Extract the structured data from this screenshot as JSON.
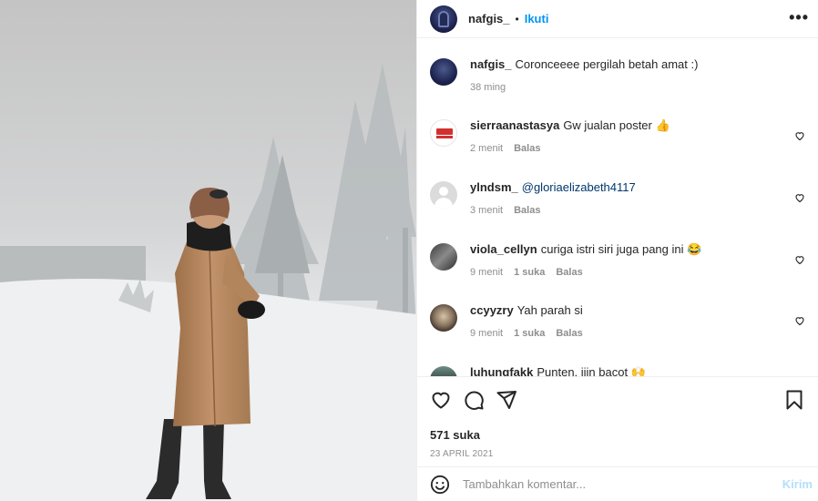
{
  "post": {
    "image_alt": "Woman in camel coat standing in snowy foggy landscape",
    "author": "nafgis_",
    "dot": "•",
    "follow_label": "Ikuti",
    "more_label": "•••"
  },
  "caption": {
    "user": "nafgis_",
    "text": "Coronceeee pergilah betah amat :)",
    "time": "38 ming"
  },
  "comments": [
    {
      "user": "sierraanastasya",
      "text": "Gw jualan poster 👍",
      "time": "2 menit",
      "likes": "",
      "reply": "Balas"
    },
    {
      "user": "ylndsm_",
      "mention": "@gloriaelizabeth4117",
      "text": "",
      "time": "3 menit",
      "likes": "",
      "reply": "Balas"
    },
    {
      "user": "viola_cellyn",
      "text": "curiga istri siri juga pang ini 😂",
      "time": "9 menit",
      "likes": "1 suka",
      "reply": "Balas"
    },
    {
      "user": "ccyyzry",
      "text": "Yah parah si",
      "time": "9 menit",
      "likes": "1 suka",
      "reply": "Balas"
    },
    {
      "user": "luhungfakk",
      "text": "Punten, ijin bacot 🙌",
      "time": "",
      "likes": "",
      "reply": ""
    }
  ],
  "stats": {
    "likes": "571 suka",
    "date": "23 APRIL 2021"
  },
  "composer": {
    "placeholder": "Tambahkan komentar...",
    "post_label": "Kirim"
  },
  "colors": {
    "accent": "#0095f6",
    "post_disabled": "#b2dffc",
    "muted": "#8e8e8e"
  },
  "icons": {
    "like": "heart-icon",
    "comment": "comment-icon",
    "share": "send-icon",
    "save": "bookmark-icon",
    "emoji": "emoji-icon",
    "more": "more-icon"
  }
}
